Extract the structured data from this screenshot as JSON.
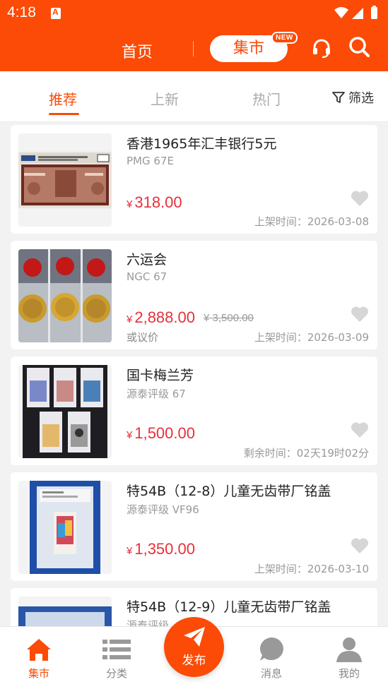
{
  "status_bar": {
    "time": "4:18"
  },
  "nav": {
    "home_label": "首页",
    "market_label": "集市",
    "new_badge": "NEW"
  },
  "tabs": [
    {
      "label": "推荐",
      "active": true
    },
    {
      "label": "上新",
      "active": false
    },
    {
      "label": "热门",
      "active": false
    }
  ],
  "filter_label": "筛选",
  "items": [
    {
      "title": "香港1965年汇丰银行5元",
      "grade": "PMG 67E",
      "price": "318.00",
      "currency": "¥",
      "original_price": "",
      "negotiable": "",
      "meta": "上架时间：2026-03-08"
    },
    {
      "title": "六运会",
      "grade": "NGC 67",
      "price": "2,888.00",
      "currency": "¥",
      "original_price": "¥ 3,500.00",
      "negotiable": "或议价",
      "meta": "上架时间：2026-03-09"
    },
    {
      "title": "国卡梅兰芳",
      "grade": "源泰评级 67",
      "price": "1,500.00",
      "currency": "¥",
      "original_price": "",
      "negotiable": "",
      "meta": "剩余时间：02天19时02分"
    },
    {
      "title": "特54B（12-8）儿童无齿带厂铭盖",
      "grade": "源泰评级 VF96",
      "price": "1,350.00",
      "currency": "¥",
      "original_price": "",
      "negotiable": "",
      "meta": "上架时间：2026-03-10"
    },
    {
      "title": "特54B（12-9）儿童无齿带厂铭盖",
      "grade": "源泰评级",
      "price": "",
      "currency": "",
      "original_price": "",
      "negotiable": "",
      "meta": ""
    }
  ],
  "tabbar": {
    "market": "集市",
    "category": "分类",
    "publish": "发布",
    "messages": "消息",
    "mine": "我的"
  },
  "colors": {
    "brand": "#fb4b06",
    "price": "#e8303a"
  }
}
